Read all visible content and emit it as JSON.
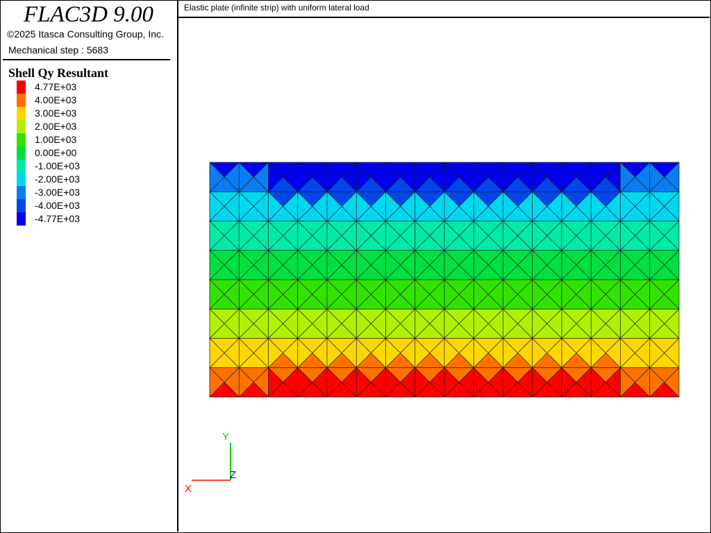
{
  "app": {
    "title": "FLAC3D 9.00",
    "copyright": "©2025 Itasca Consulting Group, Inc.",
    "step_text": "Mechanical step : 5683"
  },
  "legend": {
    "title": "Shell Qy Resultant",
    "entries": [
      {
        "label": "4.77E+03",
        "color": "#ff0000"
      },
      {
        "label": "4.00E+03",
        "color": "#ff7200"
      },
      {
        "label": "3.00E+03",
        "color": "#ffd700"
      },
      {
        "label": "2.00E+03",
        "color": "#b0f000"
      },
      {
        "label": "1.00E+03",
        "color": "#33e300"
      },
      {
        "label": "0.00E+00",
        "color": "#00e040"
      },
      {
        "label": "-1.00E+03",
        "color": "#00eaa8"
      },
      {
        "label": "-2.00E+03",
        "color": "#00d8f0"
      },
      {
        "label": "-3.00E+03",
        "color": "#0a7df2"
      },
      {
        "label": "-4.00E+03",
        "color": "#0046ea"
      },
      {
        "label": "-4.77E+03",
        "color": "#0000ee"
      }
    ]
  },
  "plot": {
    "title": "Elastic plate (infinite strip) with uniform lateral load",
    "mesh_columns": 16,
    "mesh_rows": 8,
    "row_colors": [
      "#0000ee",
      "#00d8f0",
      "#00eaa8",
      "#00e040",
      "#33e300",
      "#b0f000",
      "#ffd700",
      "#ff0000"
    ],
    "top_row_alt_color": "#0a7df2",
    "top_row_mid_color": "#0046ea",
    "bottom_row_alt_color": "#ff7200",
    "mesh_line_color": "#1a1a1a"
  },
  "axes": {
    "x_label": "X",
    "y_label": "Y",
    "z_label": "Z",
    "x_color": "#ff0000",
    "y_color": "#00cc00",
    "z_color": "#0000ff"
  }
}
